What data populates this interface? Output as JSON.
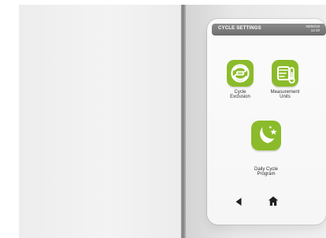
{
  "screen": {
    "title": "CYCLE SETTINGS",
    "clock": {
      "date": "09/06/18",
      "time": "12:40"
    }
  },
  "tiles": {
    "cycle_exclusion": {
      "label": "Cycle\nExclusion",
      "icon": "cycle-exclusion-icon"
    },
    "measurement_units": {
      "label": "Measurement\nUnits",
      "icon": "measurement-units-icon"
    },
    "daily_cycle_program": {
      "label": "Daily Cycle\nProgram",
      "icon": "moon-stars-icon"
    }
  },
  "nav": {
    "back": "back-arrow-icon",
    "home": "home-icon"
  },
  "colors": {
    "accent": "#8bbb2b",
    "header": "#777777",
    "screen": "#f8f8f8"
  }
}
